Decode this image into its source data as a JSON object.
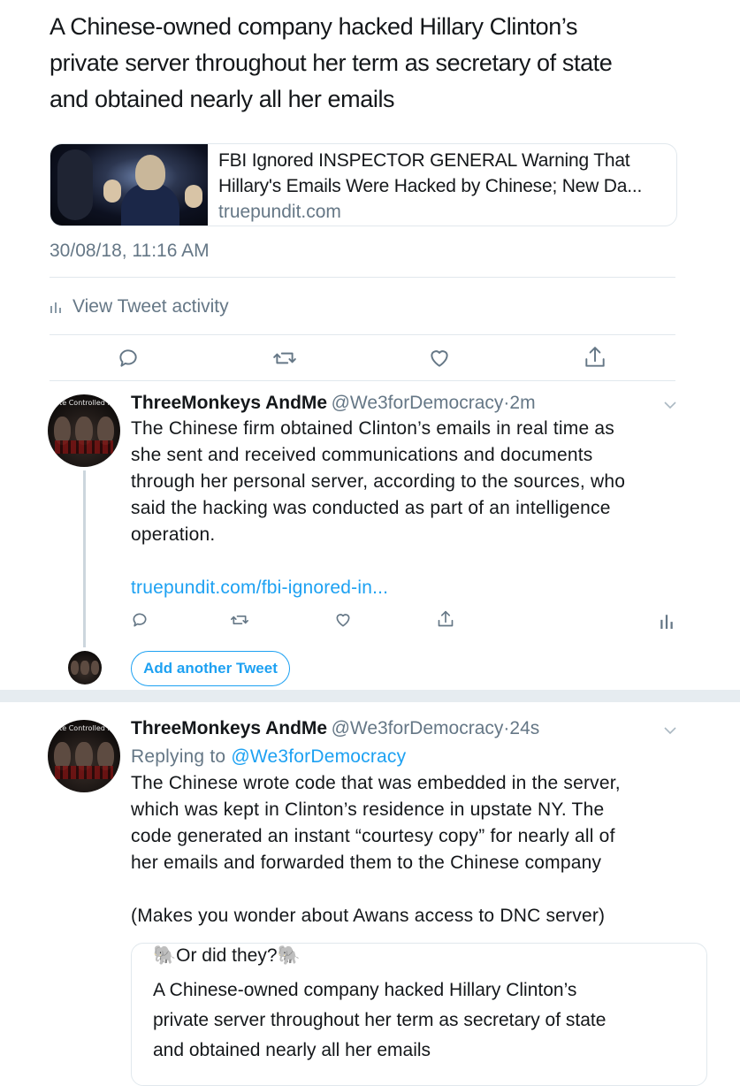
{
  "main_tweet": {
    "text_lines": [
      "A Chinese-owned company hacked Hillary Clinton’s",
      "private server throughout her term as secretary of state",
      "and obtained nearly all her emails"
    ],
    "card": {
      "title_line1": "FBI Ignored INSPECTOR GENERAL Warning That",
      "title_line2": "Hillary's Emails Were Hacked by Chinese; New Da...",
      "domain": "truepundit.com"
    },
    "timestamp": "30/08/18, 11:16 AM",
    "activity_label": "View Tweet activity"
  },
  "reply1": {
    "name": "ThreeMonkeys AndMe",
    "handle": "@We3forDemocracy",
    "separator": "·",
    "time": "2m",
    "avatar_caption": "State Controlled Media",
    "text_lines": [
      "The Chinese firm obtained Clinton’s emails in real time as",
      "she sent and received communications and documents",
      "through her personal server, according to the sources, who",
      "said the hacking was conducted as part of an intelligence",
      "operation."
    ],
    "link": "truepundit.com/fbi-ignored-in..."
  },
  "composer": {
    "add_label": "Add another Tweet"
  },
  "reply2": {
    "name": "ThreeMonkeys AndMe",
    "handle": "@We3forDemocracy",
    "separator": "·",
    "time": "24s",
    "avatar_caption": "State Controlled Media",
    "replying_prefix": "Replying to",
    "replying_handle": "@We3forDemocracy",
    "text_lines": [
      "The Chinese wrote code that was embedded in the server,",
      "which was kept in Clinton’s residence in upstate NY. The",
      "code generated an instant “courtesy copy” for nearly all of",
      "her emails and forwarded them to the Chinese company"
    ],
    "aside": "(Makes you wonder about Awans access to DNC server)",
    "quote": {
      "header": "🐘Or did they?🐘",
      "body_lines": [
        "A Chinese-owned company hacked Hillary Clinton’s",
        "private server throughout her term as secretary of state",
        "and obtained nearly all her emails"
      ]
    }
  },
  "colors": {
    "accent": "#1da1f2",
    "muted": "#657786",
    "border": "#e1e8ed",
    "text": "#14171a"
  },
  "icons": [
    "reply-icon",
    "retweet-icon",
    "like-icon",
    "share-icon",
    "analytics-icon",
    "chevron-down-icon"
  ]
}
